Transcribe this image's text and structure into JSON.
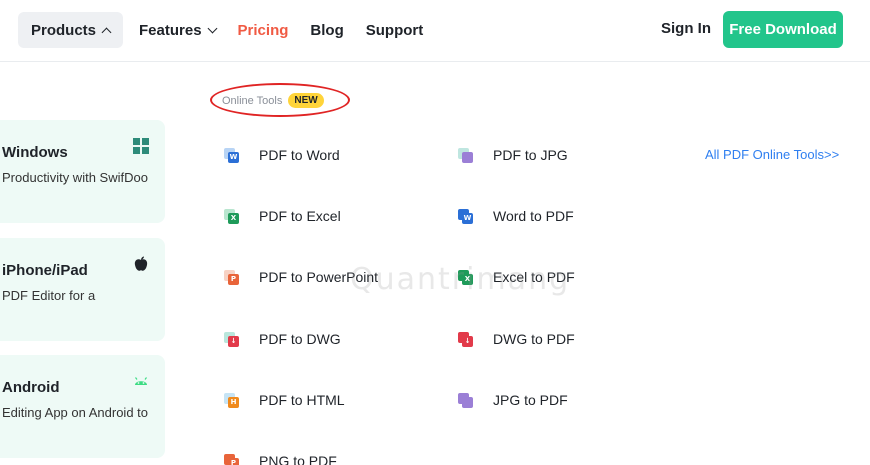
{
  "nav": {
    "items": [
      {
        "label": "Products"
      },
      {
        "label": "Features"
      },
      {
        "label": "Pricing"
      },
      {
        "label": "Blog"
      },
      {
        "label": "Support"
      }
    ],
    "sign_in": "Sign In",
    "download": "Free Download",
    "accent_color": "#22c58b",
    "pricing_color": "#f05a43"
  },
  "platforms": [
    {
      "title": "Windows",
      "desc": "Productivity with SwifDoo",
      "icon": "windows-icon"
    },
    {
      "title": "iPhone/iPad",
      "desc": "PDF Editor for a",
      "icon": "apple-icon"
    },
    {
      "title": "Android",
      "desc": "Editing App on Android to",
      "icon": "android-icon"
    }
  ],
  "section": {
    "label": "Online Tools",
    "badge": "NEW"
  },
  "tools": [
    {
      "label": "PDF to Word",
      "icon": "word-icon",
      "glyph": "W"
    },
    {
      "label": "PDF to JPG",
      "icon": "image-icon",
      "glyph": ""
    },
    {
      "label": "PDF to Excel",
      "icon": "excel-icon",
      "glyph": "X"
    },
    {
      "label": "Word to PDF",
      "icon": "word-icon",
      "glyph": "W"
    },
    {
      "label": "PDF to PowerPoint",
      "icon": "powerpoint-icon",
      "glyph": "P"
    },
    {
      "label": "Excel to PDF",
      "icon": "excel-icon",
      "glyph": "X"
    },
    {
      "label": "PDF to DWG",
      "icon": "dwg-icon",
      "glyph": "↓"
    },
    {
      "label": "DWG to PDF",
      "icon": "dwg-icon",
      "glyph": "↓"
    },
    {
      "label": "PDF to HTML",
      "icon": "html-icon",
      "glyph": "H"
    },
    {
      "label": "JPG to PDF",
      "icon": "image-icon",
      "glyph": ""
    },
    {
      "label": "PNG to PDF",
      "icon": "powerpoint-icon",
      "glyph": "P"
    }
  ],
  "all_tools_link": "All PDF Online Tools>>",
  "watermark": "Quantrimang"
}
